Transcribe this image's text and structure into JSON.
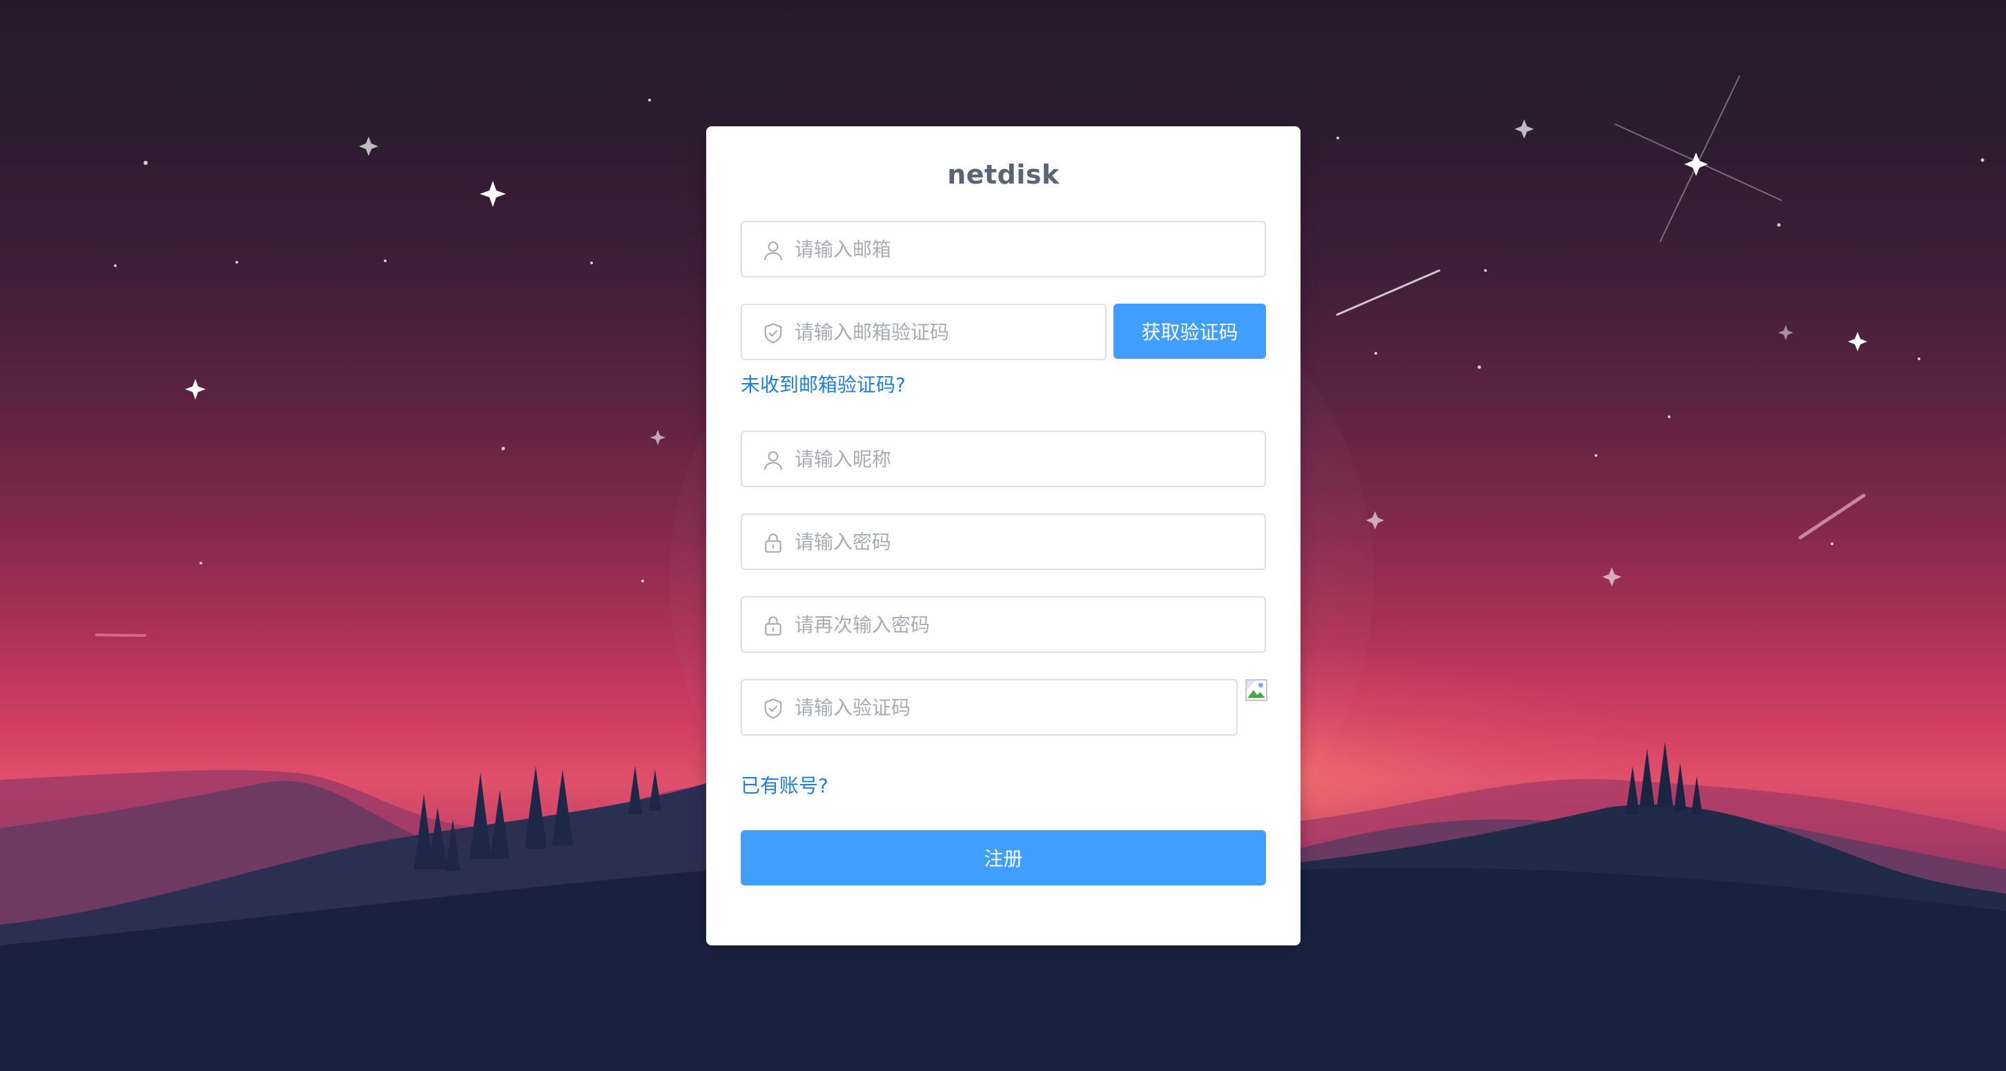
{
  "app": {
    "title": "netdisk"
  },
  "form": {
    "email": {
      "placeholder": "请输入邮箱",
      "value": ""
    },
    "email_code": {
      "placeholder": "请输入邮箱验证码",
      "value": ""
    },
    "get_code_label": "获取验证码",
    "no_code_link": "未收到邮箱验证码?",
    "nickname": {
      "placeholder": "请输入昵称",
      "value": ""
    },
    "password": {
      "placeholder": "请输入密码",
      "value": ""
    },
    "password_confirm": {
      "placeholder": "请再次输入密码",
      "value": ""
    },
    "captcha": {
      "placeholder": "请输入验证码",
      "value": ""
    },
    "have_account_link": "已有账号?",
    "register_label": "注册"
  },
  "icons": {
    "email": "user-icon",
    "email_code": "shield-check-icon",
    "nickname": "user-icon",
    "password": "lock-icon",
    "password_confirm": "lock-icon",
    "captcha": "shield-check-icon",
    "captcha_image": "broken-image-icon"
  },
  "colors": {
    "primary": "#409eff",
    "link": "#1c7fe6",
    "title": "#5a6475",
    "border": "#dcdfe6",
    "placeholder": "#a8abb2"
  }
}
